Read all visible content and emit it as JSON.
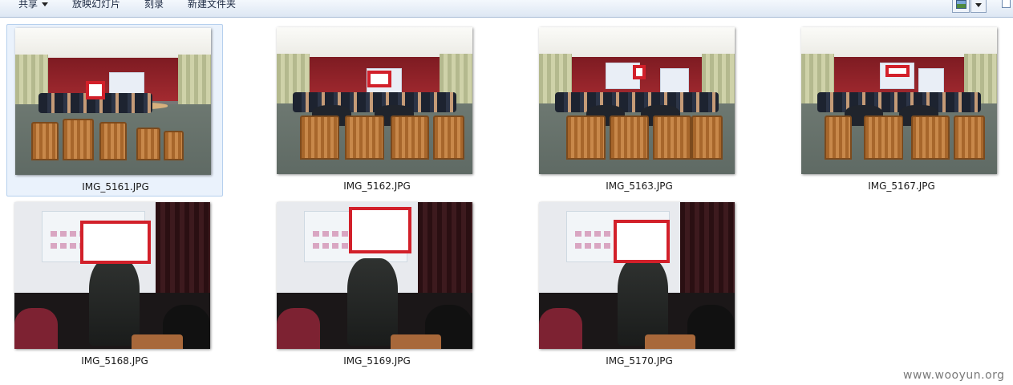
{
  "toolbar": {
    "share_label": "共享",
    "slideshow_label": "放映幻灯片",
    "burn_label": "刻录",
    "new_folder_label": "新建文件夹"
  },
  "files": [
    {
      "name": "IMG_5161.JPG",
      "selected": true
    },
    {
      "name": "IMG_5162.JPG",
      "selected": false
    },
    {
      "name": "IMG_5163.JPG",
      "selected": false
    },
    {
      "name": "IMG_5167.JPG",
      "selected": false
    },
    {
      "name": "IMG_5168.JPG",
      "selected": false
    },
    {
      "name": "IMG_5169.JPG",
      "selected": false
    },
    {
      "name": "IMG_5170.JPG",
      "selected": false
    }
  ],
  "icons": {
    "view": "change-view-icon",
    "view_dropdown": "chevron-down-icon",
    "preview_pane": "preview-pane-icon"
  },
  "colors": {
    "selection_bg": "#eaf2fc",
    "redaction_border": "#d2202a"
  },
  "watermark": "www.wooyun.org"
}
